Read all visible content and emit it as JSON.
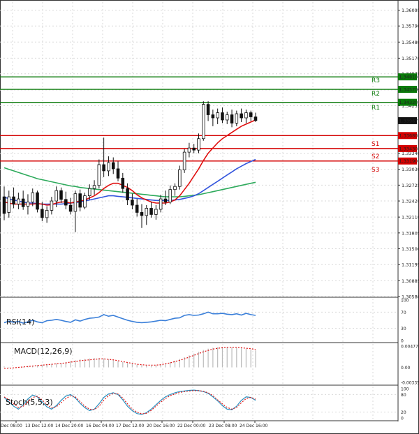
{
  "chart_data": [
    {
      "type": "candlestick",
      "panel": "price",
      "y_ticks": [
        "1.36095",
        "1.35790",
        "1.35480",
        "1.35170",
        "1.34870",
        "1.34555",
        "1.34255",
        "1.33340",
        "1.33030",
        "1.32725",
        "1.32420",
        "1.32110",
        "1.31805",
        "1.31500",
        "1.31195",
        "1.30885",
        "1.30580"
      ],
      "ylim": [
        1.3058,
        1.3625
      ],
      "current_price": "1.33967",
      "x_tick_labels": [
        "Dec 08:00",
        "13 Dec 12:00",
        "14 Dec 20:00",
        "16 Dec 04:00",
        "17 Dec 12:00",
        "20 Dec 16:00",
        "22 Dec 00:00",
        "23 Dec 08:00",
        "24 Dec 16:00"
      ],
      "levels": [
        {
          "name": "R3",
          "value": 1.3481,
          "label": "1.34810",
          "color": "#0a7a0a"
        },
        {
          "name": "R2",
          "value": 1.3457,
          "label": "1.34570",
          "color": "#0a7a0a"
        },
        {
          "name": "R1",
          "value": 1.3432,
          "label": "1.34320",
          "color": "#0a7a0a"
        },
        {
          "name": "",
          "value": 1.3368,
          "label": "1.33680",
          "color": "#d40000"
        },
        {
          "name": "S1",
          "value": 1.3343,
          "label": "1.33430",
          "color": "#d40000"
        },
        {
          "name": "S2",
          "value": 1.3319,
          "label": "1.33190",
          "color": "#d40000"
        },
        {
          "name": "S3",
          "value": null,
          "label": "",
          "color": "#d40000"
        }
      ],
      "candles": [
        [
          1.325,
          1.327,
          1.3205,
          1.3218
        ],
        [
          1.322,
          1.3262,
          1.321,
          1.325
        ],
        [
          1.325,
          1.3268,
          1.3228,
          1.3236
        ],
        [
          1.3236,
          1.3258,
          1.3226,
          1.3246
        ],
        [
          1.3246,
          1.3262,
          1.3225,
          1.3231
        ],
        [
          1.3232,
          1.3255,
          1.3216,
          1.324
        ],
        [
          1.324,
          1.3266,
          1.3232,
          1.3258
        ],
        [
          1.3258,
          1.3262,
          1.322,
          1.3226
        ],
        [
          1.3226,
          1.324,
          1.3203,
          1.321
        ],
        [
          1.321,
          1.3232,
          1.32,
          1.3224
        ],
        [
          1.3224,
          1.325,
          1.3216,
          1.3242
        ],
        [
          1.3242,
          1.327,
          1.323,
          1.3262
        ],
        [
          1.3262,
          1.3268,
          1.3238,
          1.3245
        ],
        [
          1.3245,
          1.326,
          1.3226,
          1.3234
        ],
        [
          1.3234,
          1.3248,
          1.3216,
          1.3222
        ],
        [
          1.3222,
          1.3262,
          1.3182,
          1.3256
        ],
        [
          1.3256,
          1.3264,
          1.3222,
          1.323
        ],
        [
          1.323,
          1.3258,
          1.3226,
          1.3252
        ],
        [
          1.3252,
          1.3274,
          1.3244,
          1.3266
        ],
        [
          1.3266,
          1.3282,
          1.3254,
          1.3272
        ],
        [
          1.3272,
          1.3322,
          1.3266,
          1.3312
        ],
        [
          1.3312,
          1.3364,
          1.3288,
          1.33
        ],
        [
          1.33,
          1.3328,
          1.329,
          1.3316
        ],
        [
          1.3316,
          1.3326,
          1.3294,
          1.3304
        ],
        [
          1.3304,
          1.3318,
          1.328,
          1.3286
        ],
        [
          1.3286,
          1.3296,
          1.3258,
          1.3266
        ],
        [
          1.3266,
          1.3276,
          1.3234,
          1.3244
        ],
        [
          1.3244,
          1.3256,
          1.3226,
          1.3234
        ],
        [
          1.3234,
          1.3246,
          1.3212,
          1.322
        ],
        [
          1.322,
          1.3236,
          1.319,
          1.3214
        ],
        [
          1.3214,
          1.3234,
          1.3196,
          1.3228
        ],
        [
          1.3228,
          1.324,
          1.321,
          1.3216
        ],
        [
          1.3216,
          1.3234,
          1.3206,
          1.3226
        ],
        [
          1.3226,
          1.3254,
          1.322,
          1.3246
        ],
        [
          1.3246,
          1.3262,
          1.3234,
          1.324
        ],
        [
          1.324,
          1.3272,
          1.3236,
          1.3264
        ],
        [
          1.3264,
          1.3276,
          1.3252,
          1.327
        ],
        [
          1.327,
          1.331,
          1.3264,
          1.3302
        ],
        [
          1.3302,
          1.3342,
          1.3296,
          1.3336
        ],
        [
          1.3336,
          1.3354,
          1.3326,
          1.3344
        ],
        [
          1.3344,
          1.3352,
          1.3334,
          1.334
        ],
        [
          1.334,
          1.3372,
          1.3334,
          1.3362
        ],
        [
          1.3362,
          1.3434,
          1.3358,
          1.3428
        ],
        [
          1.3428,
          1.3434,
          1.3396,
          1.3408
        ],
        [
          1.3408,
          1.3418,
          1.3386,
          1.3402
        ],
        [
          1.3402,
          1.342,
          1.339,
          1.3412
        ],
        [
          1.3412,
          1.3422,
          1.3392,
          1.3398
        ],
        [
          1.3398,
          1.3414,
          1.339,
          1.3408
        ],
        [
          1.3408,
          1.3418,
          1.3384,
          1.3392
        ],
        [
          1.3392,
          1.3416,
          1.3386,
          1.341
        ],
        [
          1.341,
          1.342,
          1.3394,
          1.3402
        ],
        [
          1.3402,
          1.3418,
          1.3392,
          1.3412
        ],
        [
          1.3412,
          1.3416,
          1.3396,
          1.3404
        ],
        [
          1.3404,
          1.3412,
          1.3394,
          1.3397
        ]
      ],
      "ma_red": [
        1.324,
        1.3238,
        1.3236,
        1.3236,
        1.3236,
        1.3236,
        1.3236,
        1.3237,
        1.3236,
        1.3234,
        1.3235,
        1.3238,
        1.324,
        1.324,
        1.3238,
        1.324,
        1.3242,
        1.3244,
        1.3248,
        1.3252,
        1.3258,
        1.3266,
        1.3272,
        1.3276,
        1.3276,
        1.3272,
        1.3268,
        1.3262,
        1.3254,
        1.3248,
        1.3244,
        1.324,
        1.3238,
        1.3238,
        1.3238,
        1.324,
        1.3244,
        1.3252,
        1.3264,
        1.3276,
        1.329,
        1.3304,
        1.332,
        1.3334,
        1.3344,
        1.3354,
        1.3362,
        1.3368,
        1.3374,
        1.338,
        1.3386,
        1.339,
        1.3394,
        1.3398
      ],
      "ma_blue": [
        1.325,
        1.3246,
        1.3244,
        1.3242,
        1.324,
        1.3238,
        1.3238,
        1.3237,
        1.3236,
        1.3236,
        1.3236,
        1.3236,
        1.3236,
        1.3237,
        1.3238,
        1.3239,
        1.324,
        1.3242,
        1.3244,
        1.3246,
        1.3248,
        1.325,
        1.3252,
        1.3252,
        1.3251,
        1.325,
        1.3249,
        1.3248,
        1.3247,
        1.3246,
        1.3245,
        1.3244,
        1.3243,
        1.3243,
        1.3243,
        1.3243,
        1.3244,
        1.3245,
        1.3247,
        1.3249,
        1.3252,
        1.3256,
        1.3262,
        1.3268,
        1.3274,
        1.328,
        1.3286,
        1.3292,
        1.3298,
        1.3304,
        1.3309,
        1.3314,
        1.3318,
        1.3322
      ],
      "ma_green": [
        1.3306,
        1.3303,
        1.33,
        1.3297,
        1.3294,
        1.3291,
        1.3288,
        1.3285,
        1.3283,
        1.3281,
        1.3279,
        1.3277,
        1.3275,
        1.3273,
        1.3271,
        1.327,
        1.3268,
        1.3267,
        1.3266,
        1.3265,
        1.3264,
        1.3263,
        1.3262,
        1.3261,
        1.326,
        1.3259,
        1.3258,
        1.3257,
        1.3256,
        1.3255,
        1.3254,
        1.3253,
        1.3252,
        1.3251,
        1.325,
        1.325,
        1.325,
        1.325,
        1.3251,
        1.3252,
        1.3253,
        1.3254,
        1.3256,
        1.3258,
        1.326,
        1.3262,
        1.3264,
        1.3266,
        1.3268,
        1.327,
        1.3272,
        1.3274,
        1.3276,
        1.3278
      ]
    },
    {
      "type": "line",
      "panel": "rsi",
      "label": "RSI(14)",
      "ylim": [
        0,
        100
      ],
      "y_ticks": [
        "100",
        "70",
        "30",
        "0"
      ],
      "values": [
        44,
        48,
        45,
        47,
        43,
        46,
        50,
        46,
        44,
        49,
        50,
        52,
        50,
        47,
        45,
        51,
        48,
        52,
        55,
        56,
        58,
        64,
        60,
        62,
        58,
        54,
        50,
        47,
        45,
        44,
        45,
        46,
        48,
        50,
        49,
        52,
        55,
        56,
        62,
        64,
        62,
        63,
        66,
        70,
        66,
        66,
        67,
        65,
        64,
        66,
        63,
        67,
        64,
        62
      ]
    },
    {
      "type": "line",
      "panel": "macd",
      "label": "MACD(12,26,9)",
      "ylim": [
        -0.003359,
        0.004778
      ],
      "y_ticks": [
        "0.004778",
        "0.00",
        "-0.003359"
      ],
      "histogram": [
        0.0002,
        0.0001,
        0.0,
        0.0,
        0.0001,
        0.0003,
        0.0004,
        0.0005,
        0.0006,
        0.0007,
        0.0008,
        0.0009,
        0.001,
        0.0012,
        0.0014,
        0.0016,
        0.0018,
        0.0019,
        0.002,
        0.0021,
        0.0021,
        0.002,
        0.0018,
        0.0016,
        0.0014,
        0.0012,
        0.001,
        0.0008,
        0.0006,
        0.0005,
        0.0004,
        0.0004,
        0.0005,
        0.0007,
        0.0009,
        0.0012,
        0.0015,
        0.0019,
        0.0023,
        0.0027,
        0.0031,
        0.0035,
        0.0039,
        0.0042,
        0.0044,
        0.0045,
        0.0046,
        0.0046,
        0.0045,
        0.0044,
        0.0043,
        0.0042,
        0.004,
        0.0038
      ],
      "signal": [
        -0.0002,
        -0.0002,
        -0.0001,
        0.0,
        0.0001,
        0.0002,
        0.0003,
        0.0004,
        0.0005,
        0.0006,
        0.0007,
        0.0008,
        0.0009,
        0.001,
        0.0012,
        0.0013,
        0.0015,
        0.0016,
        0.0017,
        0.0018,
        0.0019,
        0.0019,
        0.0018,
        0.0017,
        0.0015,
        0.0013,
        0.0011,
        0.0009,
        0.0007,
        0.0006,
        0.0005,
        0.0005,
        0.0005,
        0.0006,
        0.0008,
        0.001,
        0.0013,
        0.0016,
        0.0019,
        0.0023,
        0.0027,
        0.0031,
        0.0035,
        0.0038,
        0.0041,
        0.0043,
        0.0044,
        0.0045,
        0.0045,
        0.0045,
        0.0044,
        0.0043,
        0.0042,
        0.004
      ]
    },
    {
      "type": "line",
      "panel": "stoch",
      "label": "Stoch(5,5,3)",
      "ylim": [
        0,
        100
      ],
      "y_ticks": [
        "100",
        "80",
        "20",
        "0"
      ],
      "k": [
        70,
        55,
        40,
        30,
        45,
        65,
        78,
        72,
        55,
        38,
        30,
        42,
        60,
        75,
        80,
        68,
        50,
        35,
        25,
        30,
        48,
        70,
        82,
        86,
        80,
        62,
        40,
        25,
        15,
        12,
        18,
        30,
        45,
        60,
        72,
        80,
        86,
        90,
        92,
        94,
        95,
        93,
        90,
        84,
        72,
        58,
        42,
        30,
        28,
        40,
        60,
        72,
        70,
        60
      ],
      "d": [
        72,
        62,
        48,
        36,
        40,
        55,
        70,
        74,
        62,
        45,
        34,
        38,
        52,
        66,
        76,
        72,
        56,
        40,
        30,
        28,
        40,
        60,
        76,
        84,
        82,
        68,
        48,
        30,
        20,
        14,
        16,
        26,
        40,
        54,
        66,
        76,
        82,
        87,
        90,
        92,
        93,
        93,
        91,
        86,
        76,
        62,
        48,
        36,
        30,
        36,
        52,
        66,
        70,
        64
      ]
    }
  ]
}
